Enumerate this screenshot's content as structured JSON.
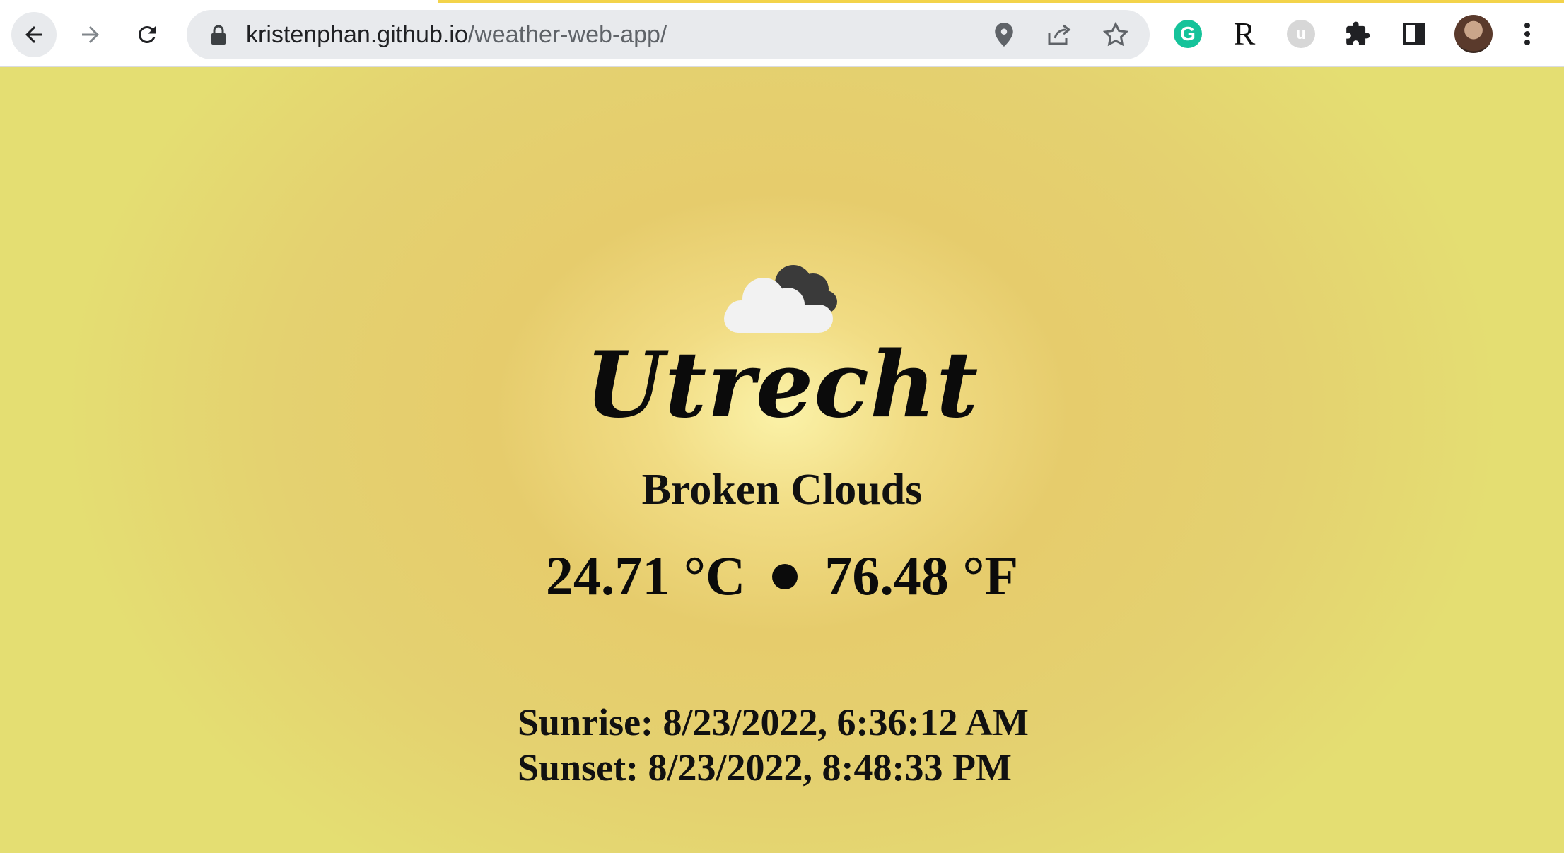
{
  "browser": {
    "url_host": "kristenphan.github.io",
    "url_path": "/weather-web-app/",
    "icons": {
      "back": "arrow-left-icon",
      "forward": "arrow-right-icon",
      "reload": "reload-icon",
      "lock": "lock-icon",
      "location": "location-pin-icon",
      "share": "share-icon",
      "bookmark": "star-icon",
      "grammarly": "grammarly-extension-icon",
      "r_extension": "r-extension-icon",
      "u_extension": "u-extension-icon",
      "extensions": "puzzle-icon",
      "side_panel": "side-panel-icon",
      "profile": "profile-avatar",
      "menu": "kebab-menu-icon"
    },
    "grammarly_letter": "G",
    "r_letter": "R",
    "u_letter": "u"
  },
  "weather": {
    "icon": "broken-clouds-icon",
    "city": "Utrecht",
    "description": "Broken Clouds",
    "temp_c": "24.71 °C",
    "temp_f": "76.48 °F",
    "sunrise": "Sunrise: 8/23/2022, 6:36:12 AM",
    "sunset": "Sunset: 8/23/2022, 8:48:33 PM"
  },
  "colors": {
    "background_center": "#fbf2a8",
    "background_outer": "#e4de72",
    "text": "#0b0b0b"
  }
}
